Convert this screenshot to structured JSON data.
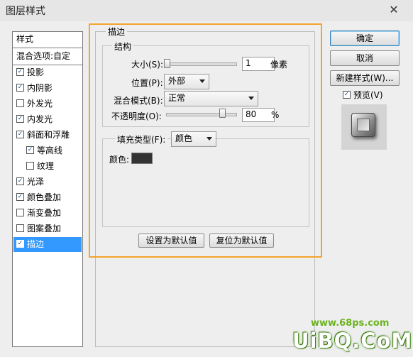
{
  "window": {
    "title": "图层样式"
  },
  "styles_panel": {
    "header": "样式",
    "blend_options": "混合选项:自定",
    "items": [
      {
        "label": "投影",
        "checked": true
      },
      {
        "label": "内阴影",
        "checked": true
      },
      {
        "label": "外发光",
        "checked": false
      },
      {
        "label": "内发光",
        "checked": true
      },
      {
        "label": "斜面和浮雕",
        "checked": true
      },
      {
        "label": "等高线",
        "checked": true
      },
      {
        "label": "纹理",
        "checked": false
      },
      {
        "label": "光泽",
        "checked": true
      },
      {
        "label": "颜色叠加",
        "checked": true
      },
      {
        "label": "渐变叠加",
        "checked": false
      },
      {
        "label": "图案叠加",
        "checked": false
      },
      {
        "label": "描边",
        "checked": true,
        "selected": true
      }
    ]
  },
  "stroke": {
    "section_title": "描边",
    "structure_title": "结构",
    "size_label": "大小(S):",
    "size_value": "1",
    "size_unit": "像素",
    "position_label": "位置(P):",
    "position_value": "外部",
    "blend_mode_label": "混合模式(B):",
    "blend_mode_value": "正常",
    "opacity_label": "不透明度(O):",
    "opacity_value": "80",
    "opacity_unit": "%",
    "fill_type_label": "填充类型(F):",
    "fill_type_value": "颜色",
    "color_label": "颜色:",
    "stroke_color": "#333333",
    "set_default_button": "设置为默认值",
    "reset_default_button": "复位为默认值"
  },
  "actions": {
    "ok": "确定",
    "cancel": "取消",
    "new_style": "新建样式(W)...",
    "preview_label": "预览(V)",
    "preview_checked": true
  },
  "watermark": {
    "site": "www.68ps.com",
    "brand": "UiBQ.CoM"
  },
  "colors": {
    "highlight": "#f4a52c",
    "selection": "#3399ff",
    "watermark_green": "#7ec422"
  }
}
